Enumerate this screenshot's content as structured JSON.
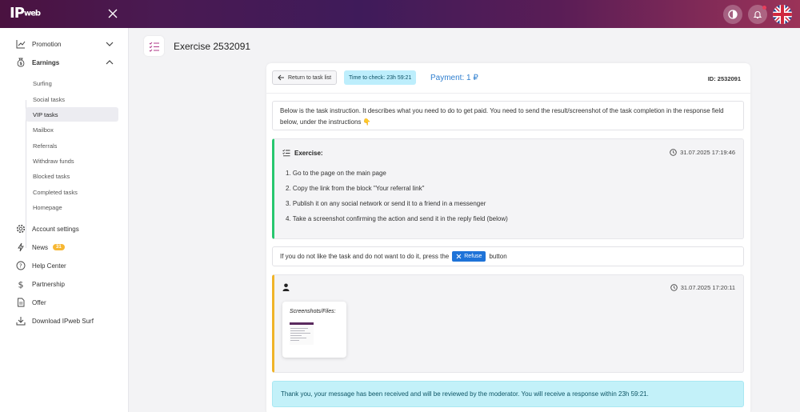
{
  "header": {
    "logo_main": "IP",
    "logo_sub": "web",
    "icons": [
      "close-icon",
      "theme-toggle-icon",
      "bell-icon",
      "uk-flag-icon"
    ],
    "accent_colors": [
      "#4a1240",
      "#9b3358"
    ]
  },
  "sidebar": {
    "promotion": "Promotion",
    "earnings": "Earnings",
    "sub_items": [
      "Surfing",
      "Social tasks",
      "VIP tasks",
      "Mailbox",
      "Referrals",
      "Withdraw funds",
      "Blocked tasks",
      "Completed tasks",
      "Homepage"
    ],
    "account_settings": "Account settings",
    "news": "News",
    "news_badge": "31",
    "help_center": "Help Center",
    "partnership": "Partnership",
    "offer": "Offer",
    "download": "Download IPweb Surf"
  },
  "page": {
    "title": "Exercise 2532091"
  },
  "task": {
    "back_label": "Return to task list",
    "time_badge": "Time to check: 23h 59:21",
    "payment": "Payment: 1 ₽",
    "id": "ID: 2532091",
    "intro": "Below is the task instruction. It describes what you need to do to get paid. You need to send the result/screenshot of the task completion in the response field below, under the instructions 👇",
    "exercise_label": "Exercise:",
    "exercise_date": "31.07.2025 17:19:46",
    "steps": [
      "1. Go to the page on the main page",
      "2. Copy the link from the block \"Your referral link\"",
      "3. Publish it on any social network or send it to a friend in a messenger",
      "4. Take a screenshot confirming the action and send it in the reply field (below)"
    ],
    "refuse_before": "If you do not like the task and do not want to do it, press the",
    "refuse_label": "Refuse",
    "refuse_after": "button",
    "reply_date": "31.07.2025 17:20:11",
    "screenshots_label": "Screenshots/Files:",
    "notice": "Thank you, your message has been received and will be reviewed by the moderator. You will receive a response within 23h 59:21."
  }
}
